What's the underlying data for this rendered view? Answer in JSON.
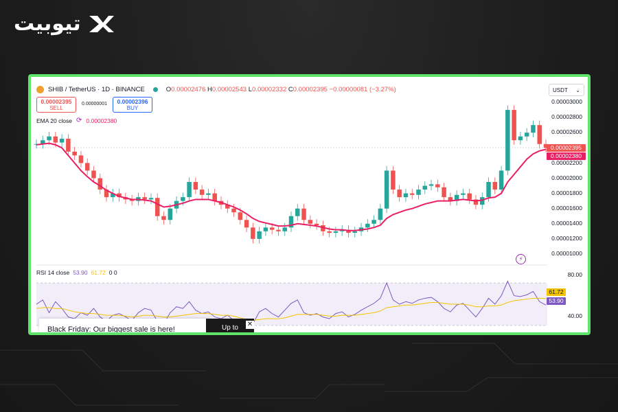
{
  "brand": {
    "logo_text": "تیوبیت"
  },
  "header": {
    "symbol": "SHIB / TetherUS · 1D · BINANCE",
    "ohlc": [
      {
        "k": "O",
        "v": "0.00002476"
      },
      {
        "k": "H",
        "v": "0.00002543"
      },
      {
        "k": "L",
        "v": "0.00002332"
      },
      {
        "k": "C",
        "v": "0.00002395"
      }
    ],
    "change": "−0.00000081 (−3.27%)"
  },
  "trade": {
    "sell_price": "0.00002395",
    "sell_label": "SELL",
    "spread": "0.00000001",
    "buy_price": "0.00002396",
    "buy_label": "BUY"
  },
  "ema": {
    "label": "EMA 20 close",
    "value": "0.00002380"
  },
  "currency": {
    "selected": "USDT"
  },
  "price_axis": {
    "labels": [
      "0.00003000",
      "0.00002800",
      "0.00002600",
      "0.00002400",
      "0.00002200",
      "0.00002000",
      "0.00001800",
      "0.00001600",
      "0.00001400",
      "0.00001200",
      "0.00001000"
    ],
    "last_price_tag": "0.00002395",
    "ema_tag": "0.00002380"
  },
  "rsi": {
    "label": "RSI 14 close",
    "value": "53.90",
    "ma_value": "61.72",
    "extra": "0 0",
    "axis": [
      "80.00",
      "40.00"
    ]
  },
  "ad": {
    "text": "Black Friday: Our biggest sale is here!",
    "img_text": "Up to"
  },
  "colors": {
    "frame": "#5fe36b",
    "up": "#26a69a",
    "down": "#ef5350",
    "ema": "#e91e63",
    "rsi": "#7e57c2",
    "rsi_ma": "#f5c400"
  },
  "chart_data": {
    "type": "candlestick",
    "close": [
      2.45,
      2.5,
      2.55,
      2.47,
      2.52,
      2.35,
      2.3,
      2.2,
      2.1,
      2.0,
      1.85,
      1.75,
      1.8,
      1.75,
      1.72,
      1.7,
      1.75,
      1.72,
      1.74,
      1.5,
      1.45,
      1.6,
      1.7,
      1.75,
      1.95,
      1.85,
      1.78,
      1.8,
      1.7,
      1.65,
      1.6,
      1.55,
      1.45,
      1.35,
      1.2,
      1.3,
      1.35,
      1.32,
      1.3,
      1.35,
      1.5,
      1.6,
      1.45,
      1.4,
      1.38,
      1.3,
      1.28,
      1.3,
      1.32,
      1.28,
      1.3,
      1.35,
      1.4,
      1.45,
      1.6,
      2.1,
      1.85,
      1.75,
      1.8,
      1.78,
      1.85,
      1.9,
      1.92,
      1.88,
      1.75,
      1.7,
      1.78,
      1.8,
      1.72,
      1.65,
      1.75,
      1.95,
      1.85,
      2.1,
      2.9,
      2.5,
      2.55,
      2.6,
      2.7,
      2.45,
      2.4
    ],
    "ema": [
      2.44,
      2.45,
      2.46,
      2.44,
      2.4,
      2.3,
      2.2,
      2.1,
      2.02,
      1.95,
      1.9,
      1.84,
      1.8,
      1.76,
      1.74,
      1.72,
      1.72,
      1.71,
      1.7,
      1.66,
      1.62,
      1.63,
      1.65,
      1.67,
      1.7,
      1.72,
      1.72,
      1.72,
      1.7,
      1.68,
      1.65,
      1.62,
      1.58,
      1.53,
      1.47,
      1.43,
      1.41,
      1.39,
      1.37,
      1.37,
      1.38,
      1.4,
      1.39,
      1.38,
      1.37,
      1.35,
      1.33,
      1.32,
      1.32,
      1.31,
      1.31,
      1.32,
      1.33,
      1.35,
      1.38,
      1.47,
      1.52,
      1.55,
      1.58,
      1.6,
      1.63,
      1.66,
      1.68,
      1.7,
      1.7,
      1.7,
      1.71,
      1.72,
      1.71,
      1.7,
      1.71,
      1.74,
      1.75,
      1.8,
      1.95,
      2.05,
      2.15,
      2.25,
      2.32,
      2.36,
      2.38
    ],
    "rsi": [
      55,
      60,
      45,
      58,
      50,
      40,
      38,
      45,
      42,
      50,
      40,
      35,
      42,
      44,
      40,
      36,
      45,
      50,
      48,
      35,
      32,
      45,
      52,
      50,
      58,
      48,
      44,
      46,
      40,
      38,
      42,
      36,
      30,
      28,
      32,
      46,
      50,
      44,
      40,
      48,
      56,
      60,
      45,
      42,
      44,
      40,
      38,
      44,
      46,
      40,
      43,
      48,
      52,
      56,
      62,
      80,
      60,
      55,
      58,
      56,
      60,
      62,
      63,
      58,
      50,
      46,
      54,
      56,
      48,
      40,
      50,
      62,
      55,
      65,
      82,
      65,
      64,
      66,
      70,
      58,
      54
    ],
    "rsi_ma": [
      50,
      51,
      51,
      50,
      50,
      48,
      46,
      45,
      44,
      44,
      43,
      42,
      42,
      42,
      41,
      40,
      41,
      42,
      42,
      41,
      40,
      40,
      41,
      42,
      43,
      44,
      44,
      44,
      43,
      42,
      42,
      41,
      39,
      37,
      36,
      37,
      38,
      38,
      38,
      39,
      41,
      43,
      43,
      43,
      43,
      42,
      41,
      41,
      42,
      42,
      42,
      43,
      44,
      45,
      47,
      51,
      52,
      53,
      54,
      54,
      55,
      56,
      57,
      57,
      56,
      55,
      55,
      55,
      54,
      52,
      52,
      53,
      53,
      54,
      57,
      59,
      60,
      61,
      62,
      62,
      61.72
    ],
    "ylim": [
      1.0,
      3.0
    ],
    "unit_note_hidden": false
  }
}
